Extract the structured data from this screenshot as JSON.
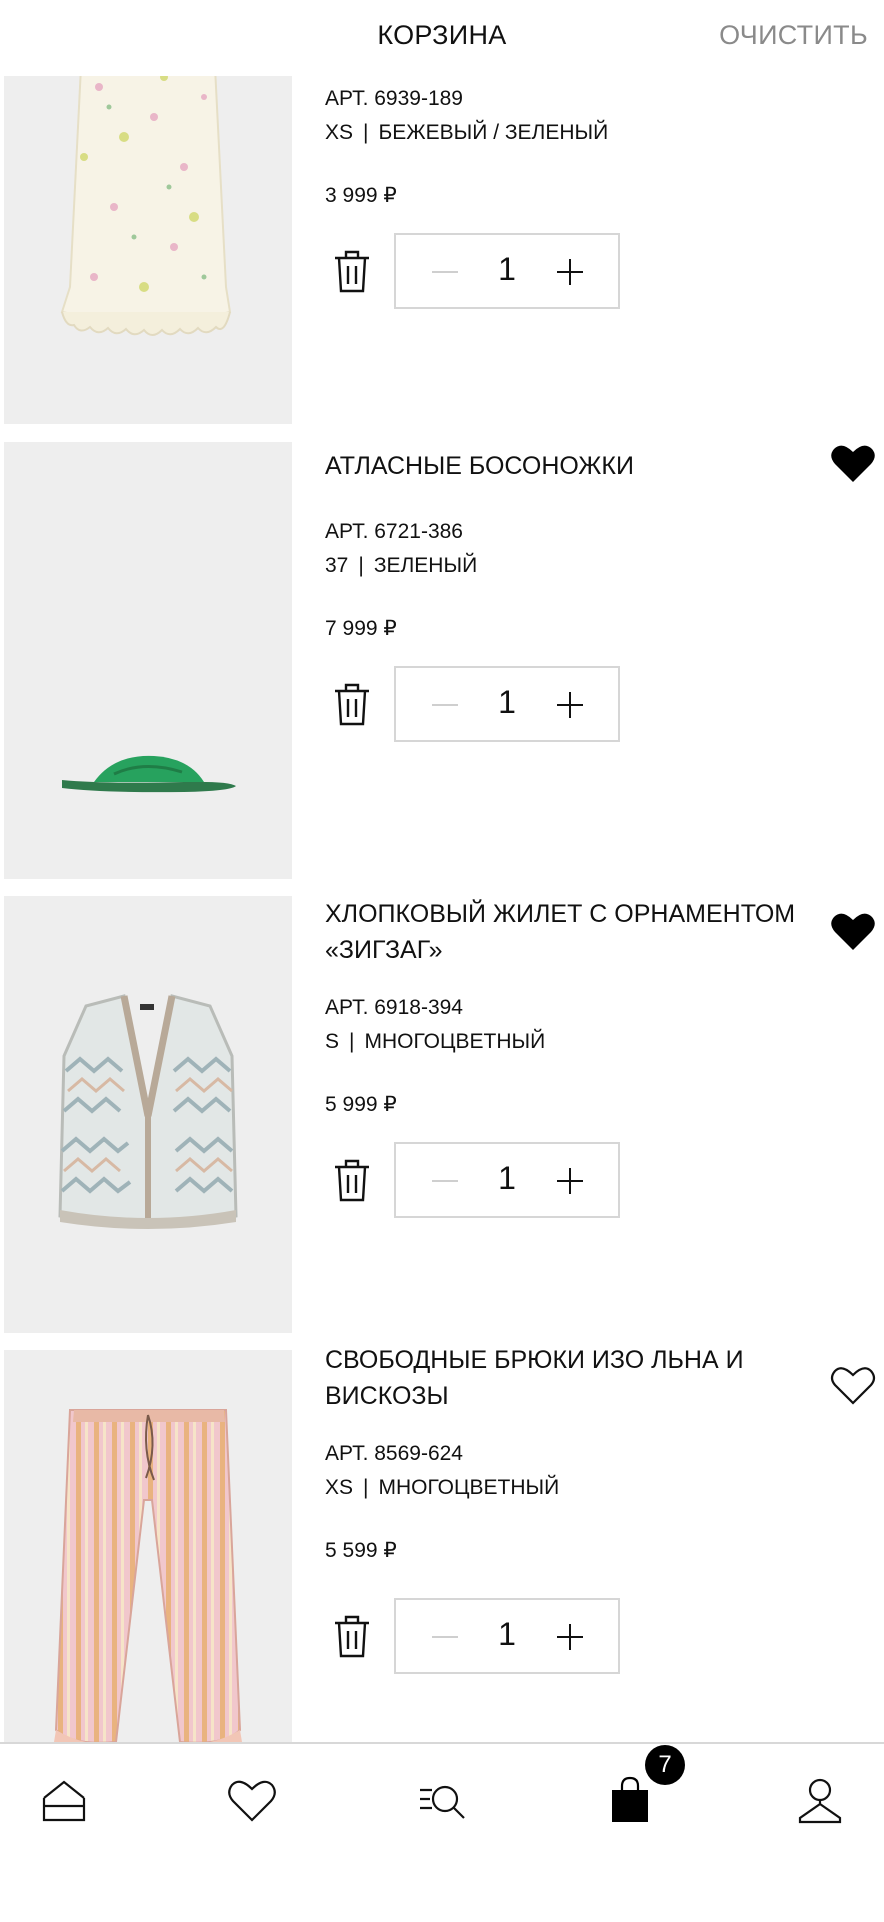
{
  "header": {
    "title": "КОРЗИНА",
    "clear_label": "ОЧИСТИТЬ"
  },
  "items": [
    {
      "name": "",
      "article": "АРТ. 6939-189",
      "size": "XS",
      "color": "БЕЖЕВЫЙ / ЗЕЛЕНЫЙ",
      "price": "3 999 ₽",
      "quantity": "1",
      "favorite": false,
      "image": "floral-skirt"
    },
    {
      "name": "АТЛАСНЫЕ БОСОНОЖКИ",
      "article": "АРТ. 6721-386",
      "size": "37",
      "color": "ЗЕЛЕНЫЙ",
      "price": "7 999 ₽",
      "quantity": "1",
      "favorite": true,
      "image": "green-slide-sandal"
    },
    {
      "name": "ХЛОПКОВЫЙ ЖИЛЕТ С ОРНАМЕНТОМ «ЗИГЗАГ»",
      "article": "АРТ. 6918-394",
      "size": "S",
      "color": "МНОГОЦВЕТНЫЙ",
      "price": "5 999 ₽",
      "quantity": "1",
      "favorite": true,
      "image": "zigzag-knit-vest"
    },
    {
      "name": "СВОБОДНЫЕ БРЮКИ ИЗО ЛЬНА И ВИСКОЗЫ",
      "article": "АРТ. 8569-624",
      "size": "XS",
      "color": "МНОГОЦВЕТНЫЙ",
      "price": "5 599 ₽",
      "quantity": "1",
      "favorite": false,
      "image": "striped-linen-trousers"
    }
  ],
  "separator": "|",
  "tabbar": {
    "tabs": [
      "home-icon",
      "heart-icon",
      "search-catalog-icon",
      "cart-icon",
      "profile-icon"
    ],
    "cart_badge": "7"
  },
  "colors": {
    "accent": "#000000",
    "muted": "#8a8a8a",
    "thumb_bg": "#eeeeee"
  }
}
